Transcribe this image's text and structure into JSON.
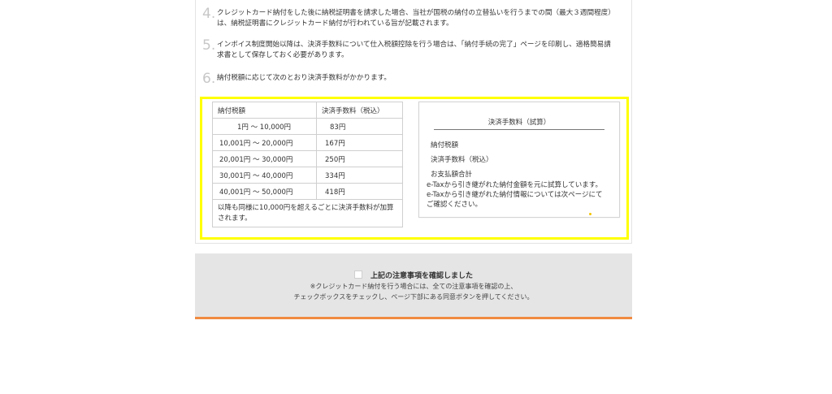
{
  "notes": [
    {
      "num": "4.",
      "lines": [
        "クレジットカード納付をした後に納税証明書を請求した場合、当社が国税の納付の立替払いを行うまでの間（最大３週間程度）",
        "は、納税証明書にクレジットカード納付が行われている旨が記載されます。"
      ]
    },
    {
      "num": "5.",
      "lines": [
        "インボイス制度開始以降は、決済手数料について仕入税額控除を行う場合は、「納付手続の完了」ページを印刷し、適格簡易請",
        "求書として保存しておく必要があります。"
      ]
    },
    {
      "num": "6.",
      "lines": [
        "納付税額に応じて次のとおり決済手数料がかかります。"
      ]
    }
  ],
  "fee_table": {
    "headers": [
      "納付税額",
      "決済手数料（税込）"
    ],
    "rows": [
      {
        "range": "1円 ～ 10,000円",
        "fee": "83円"
      },
      {
        "range": "10,001円 ～ 20,000円",
        "fee": "167円"
      },
      {
        "range": "20,001円 ～ 30,000円",
        "fee": "250円"
      },
      {
        "range": "30,001円 ～ 40,000円",
        "fee": "334円"
      },
      {
        "range": "40,001円 ～ 50,000円",
        "fee": "418円"
      }
    ],
    "footnote_1": "以降も同様に10,000円を超えるごとに決済手数料が加算",
    "footnote_2": "されます。"
  },
  "trial": {
    "title": "決済手数料（試算）",
    "tax_label": "納付税額",
    "fee_label": "決済手数料（税込）",
    "total_label": "お支払額合計",
    "msg_1": "e-Taxから引き継がれた納付金額を元に試算しています。",
    "msg_2": "e-Taxから引き継がれた納付情報については次ページにて",
    "msg_3": "ご確認ください。"
  },
  "confirm": {
    "checkbox_label": "上記の注意事項を確認しました",
    "sub_1": "※クレジットカード納付を行う場合には、全ての注意事項を確認の上、",
    "sub_2": "チェックボックスをチェックし、ページ下部にある同意ボタンを押してください。"
  },
  "colors": {
    "highlight": "#ffff00",
    "accent": "#f08a40",
    "confirm_bg": "#e5e5e5"
  }
}
